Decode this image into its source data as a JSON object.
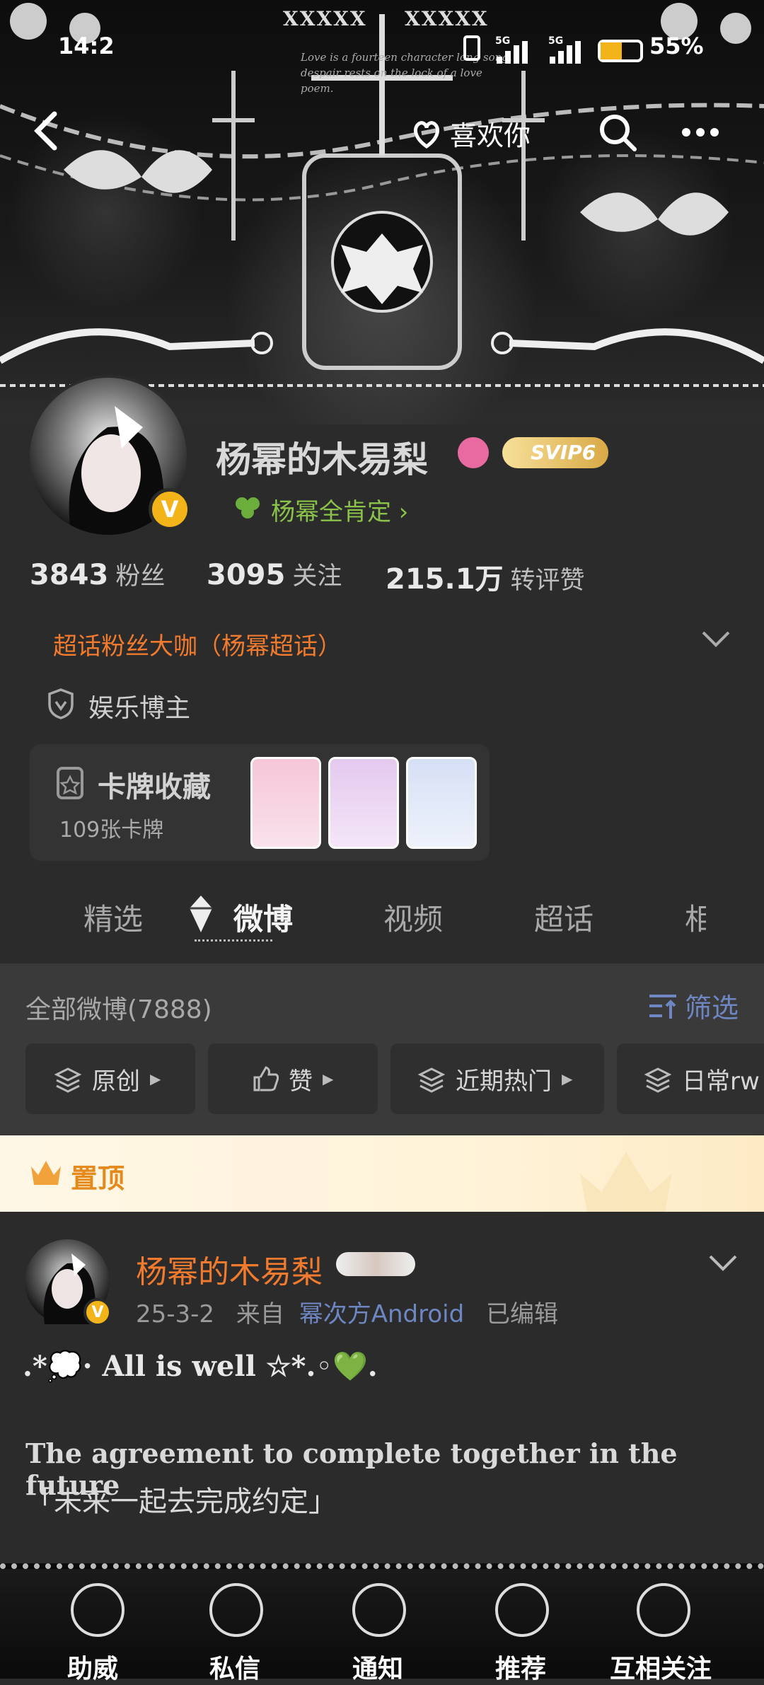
{
  "status_bar": {
    "time": "14:2",
    "network_1": "5G",
    "network_2": "5G",
    "battery": "55%"
  },
  "banner": {
    "decor_left": "XXXXX",
    "decor_right": "XXXXX",
    "poem": "Love is a fourteen character long song, despair rests on the lock of a love poem."
  },
  "nav": {
    "back_icon": "back-arrow-icon",
    "like_label": "喜欢你",
    "search_icon": "search-icon",
    "more_icon": "more-dots-icon"
  },
  "profile": {
    "name": "杨幂的木易梨",
    "vip_label": "SVIP6",
    "tagline": "杨幂全肯定 ›",
    "verified_badge": "V",
    "stats": [
      {
        "value": "3843",
        "label": "粉丝"
      },
      {
        "value": "3095",
        "label": "关注"
      },
      {
        "value": "215.1万",
        "label": "转评赞"
      }
    ],
    "fan_badge": "超话粉丝大咖（杨幂超话）",
    "blogger_type": "娱乐博主"
  },
  "cards": {
    "title": "卡牌收藏",
    "count": "109张卡牌"
  },
  "tabs": [
    {
      "label": "精选",
      "active": false
    },
    {
      "label": "微博",
      "active": true
    },
    {
      "label": "视频",
      "active": false
    },
    {
      "label": "超话",
      "active": false
    },
    {
      "label": "相",
      "active": false
    }
  ],
  "filter": {
    "all_posts": "全部微博(7888)",
    "filter_label": "筛选",
    "chips": [
      "原创",
      "赞",
      "近期热门",
      "日常rw"
    ]
  },
  "pinned": {
    "label": "置顶"
  },
  "post": {
    "author": "杨幂的木易梨",
    "date": "25-3-2",
    "from_label": "来自",
    "source": "幂次方Android",
    "edited": "已编辑",
    "line1": ".*💭· All is well ☆*.◦💚.",
    "line2": "The agreement to complete together in the future",
    "line3": "「未来一起去完成约定」"
  },
  "bottom_bar": {
    "items": [
      "助威",
      "私信",
      "通知",
      "推荐",
      "互相关注"
    ]
  },
  "colors": {
    "accent_orange": "#f07a2d",
    "green": "#8bc24a",
    "link_blue": "#6e86c2",
    "verified_gold": "#f2b418"
  }
}
